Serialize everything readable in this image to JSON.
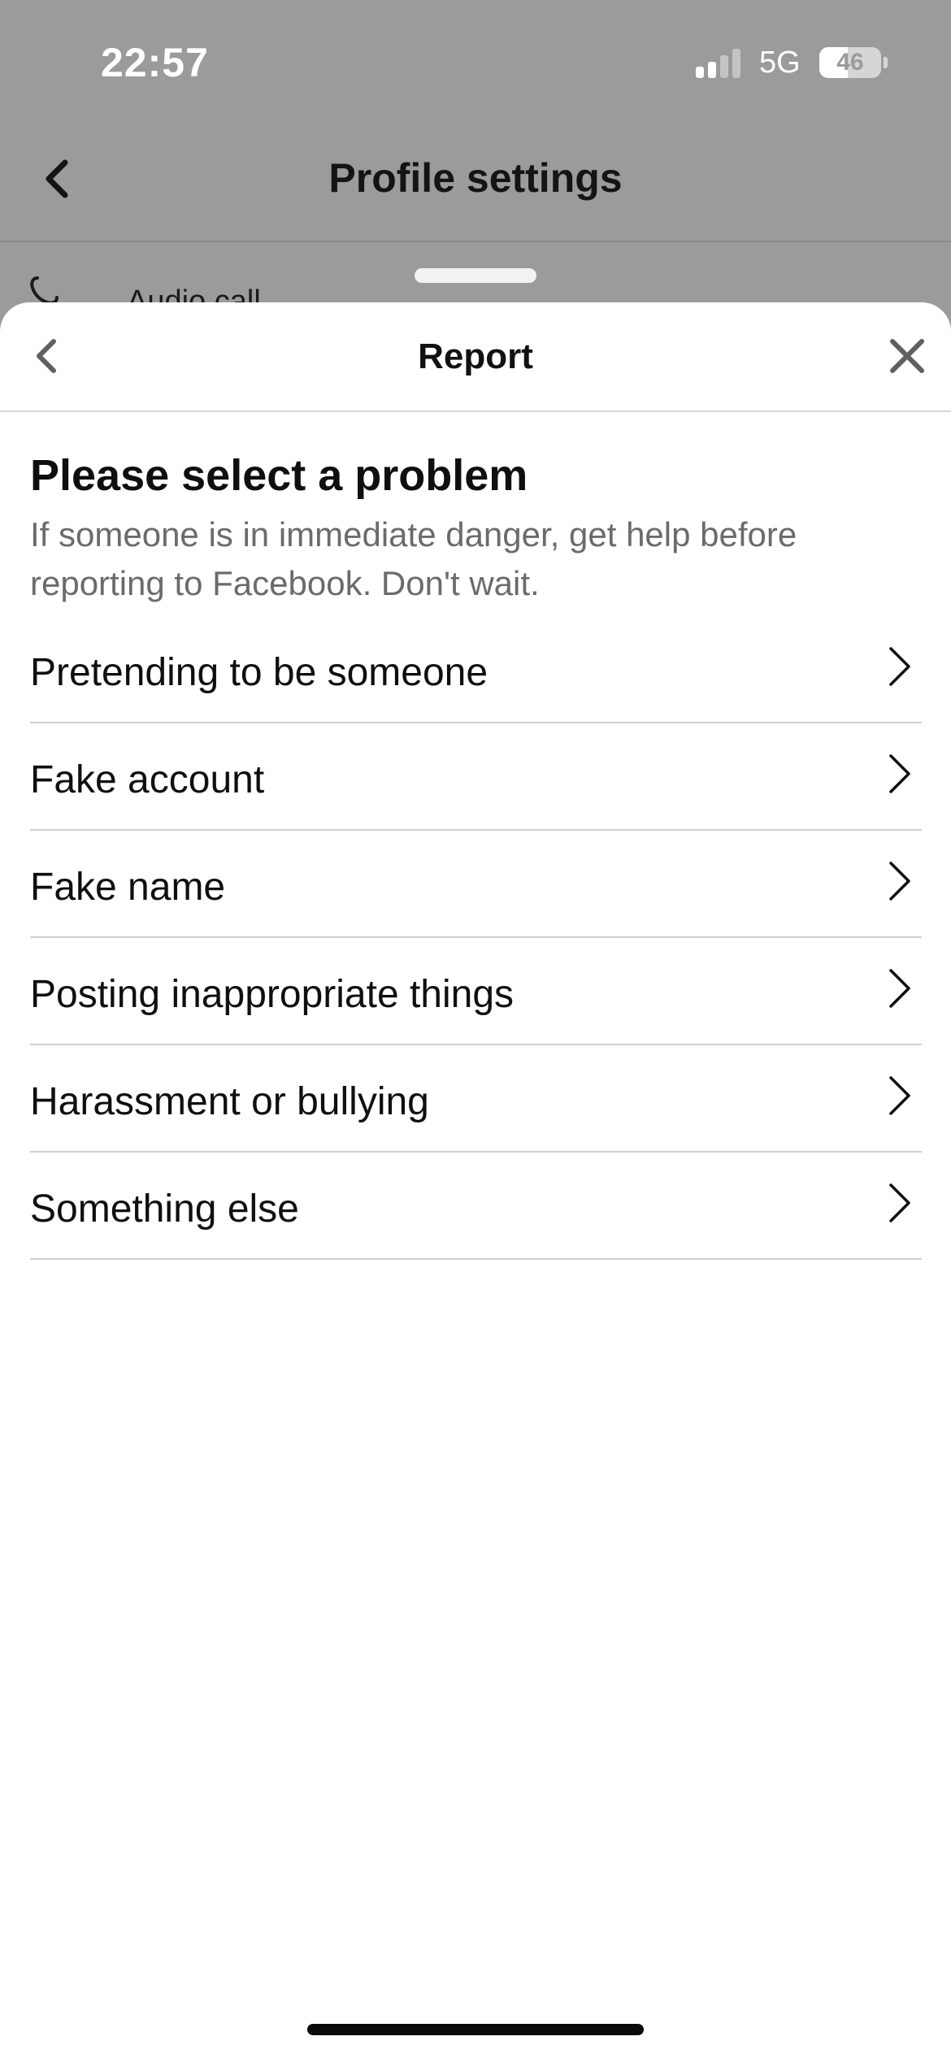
{
  "status_bar": {
    "time": "22:57",
    "network": "5G",
    "battery": "46",
    "battery_level_percent": 46,
    "signal_bars_active": 2,
    "signal_bars_total": 4
  },
  "background_screen": {
    "title": "Profile settings",
    "partial_row_label": "Audio call"
  },
  "sheet": {
    "title": "Report",
    "heading": "Please select a problem",
    "subtext": "If someone is in immediate danger, get help before reporting to Facebook. Don't wait.",
    "options": [
      {
        "label": "Pretending to be someone",
        "icon": "chevron-right-icon"
      },
      {
        "label": "Fake account",
        "icon": "chevron-right-icon"
      },
      {
        "label": "Fake name",
        "icon": "chevron-right-icon"
      },
      {
        "label": "Posting inappropriate things",
        "icon": "chevron-right-icon"
      },
      {
        "label": "Harassment or bullying",
        "icon": "chevron-right-icon"
      },
      {
        "label": "Something else",
        "icon": "chevron-right-icon"
      }
    ]
  },
  "icons": {
    "back": "chevron-left-icon",
    "close": "close-icon",
    "call": "phone-icon"
  },
  "colors": {
    "dim_overlay": "#9b9b9b",
    "sheet_background": "#ffffff",
    "primary_text": "#0f0f0f",
    "secondary_text": "#6b6b6b",
    "divider": "#cfcfcf"
  }
}
